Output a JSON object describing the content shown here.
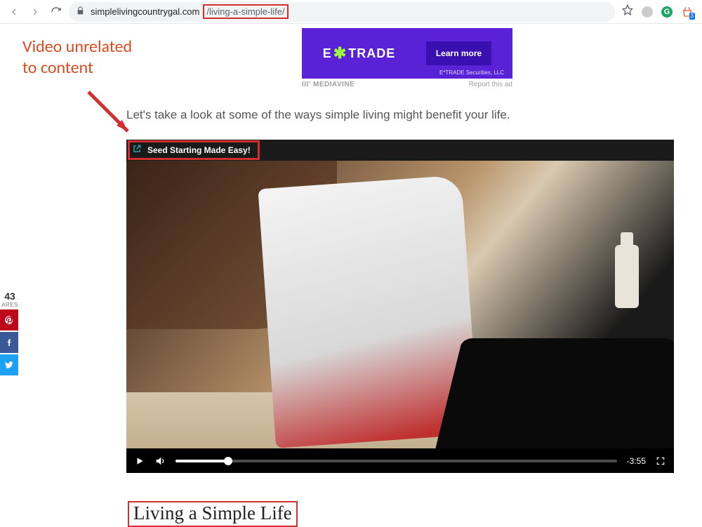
{
  "browser": {
    "url_domain": "simplelivingcountrygal.com",
    "url_path": "/living-a-simple-life/",
    "ext_badge": "3",
    "ext_g": "G"
  },
  "annotation": {
    "line1": "Video unrelated",
    "line2": "to content"
  },
  "ad": {
    "logo_a": "E",
    "logo_b": "TRADE",
    "button": "Learn more",
    "sub": "E*TRADE Securities, LLC",
    "mediavine": "III' MEDIAVINE",
    "report": "Report this ad"
  },
  "article": {
    "paragraph": "Let's take a look at some of the ways simple living might benefit your life.",
    "video_title": "Seed Starting Made Easy!",
    "time_remaining": "-3:55",
    "heading": "Living a Simple Life"
  },
  "share": {
    "count": "43",
    "label": "ARES"
  }
}
